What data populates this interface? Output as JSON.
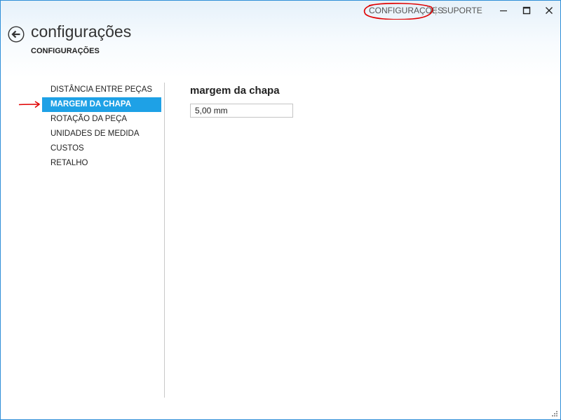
{
  "top_nav": {
    "settings_label": "CONFIGURAÇÕES",
    "support_label": "SUPORTE"
  },
  "window_controls": {
    "minimize_icon": "minimize-icon",
    "maximize_icon": "maximize-icon",
    "close_icon": "close-icon"
  },
  "header": {
    "back_icon": "back-arrow-icon",
    "title": "configurações",
    "breadcrumb": "CONFIGURAÇÕES"
  },
  "sidebar": {
    "selected_index": 1,
    "items": [
      {
        "label": "DISTÂNCIA ENTRE PEÇAS"
      },
      {
        "label": "MARGEM DA CHAPA"
      },
      {
        "label": "ROTAÇÃO DA PEÇA"
      },
      {
        "label": "UNIDADES DE MEDIDA"
      },
      {
        "label": "CUSTOS"
      },
      {
        "label": "RETALHO"
      }
    ]
  },
  "main": {
    "section_title": "margem da chapa",
    "margin_value": "5,00 mm"
  },
  "colors": {
    "accent": "#1ea1e6",
    "window_border": "#2f8fd8",
    "annotation": "#e00000"
  }
}
